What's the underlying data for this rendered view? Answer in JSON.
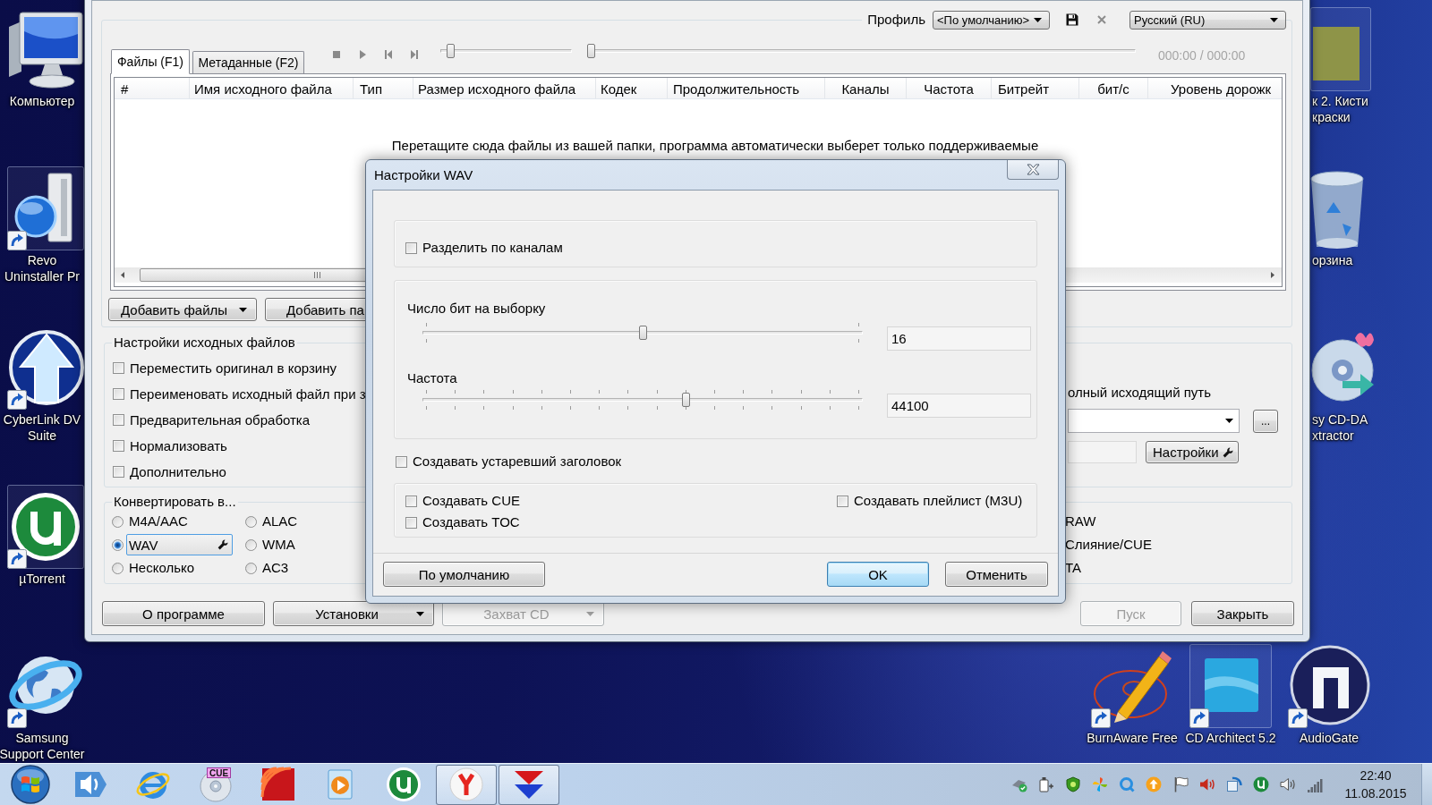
{
  "desktop": {
    "left_icons": [
      {
        "kind": "computer",
        "label_lines": [
          "Компьютер"
        ],
        "selected": false,
        "shortcut": false
      },
      {
        "kind": "uninstaller",
        "label_lines": [
          "Revo",
          "Uninstaller Pr"
        ],
        "selected": true,
        "shortcut": true
      },
      {
        "kind": "upload",
        "label_lines": [
          "CyberLink DV",
          "Suite"
        ],
        "selected": false,
        "shortcut": true
      },
      {
        "kind": "torrent",
        "label_lines": [
          "µTorrent"
        ],
        "selected": true,
        "shortcut": true
      },
      {
        "kind": "globe",
        "label_lines": [
          "Samsung",
          "Support Center"
        ],
        "selected": false,
        "shortcut": true
      }
    ],
    "right_icons": [
      {
        "kind": "photo",
        "label_lines": [
          "к 2. Кисти",
          "краски"
        ],
        "selected": true,
        "shortcut": false
      },
      {
        "kind": "bin",
        "label_lines": [
          "орзина"
        ],
        "selected": false,
        "shortcut": false
      },
      {
        "kind": "disc",
        "label_lines": [
          "sy CD-DA",
          "xtractor"
        ],
        "selected": false,
        "shortcut": false
      }
    ],
    "bottom_icons": [
      {
        "kind": "pencil",
        "label_lines": [
          "BurnAware Free"
        ],
        "selected": false,
        "shortcut": true
      },
      {
        "kind": "tile",
        "label_lines": [
          "CD Architect 5.2"
        ],
        "selected": true,
        "shortcut": true
      },
      {
        "kind": "arch",
        "label_lines": [
          "AudioGate"
        ],
        "selected": false,
        "shortcut": true
      }
    ]
  },
  "app": {
    "profile": {
      "label": "Профиль",
      "value": "<По умолчанию>"
    },
    "language": "Русский (RU)",
    "tabs": [
      {
        "label": "Файлы (F1)",
        "selected": true
      },
      {
        "label": "Метаданные (F2)",
        "selected": false
      }
    ],
    "player": {
      "buttons": [
        {
          "kind": "stop"
        },
        {
          "kind": "play"
        },
        {
          "kind": "previous"
        },
        {
          "kind": "next"
        }
      ],
      "sliders": [
        {
          "level": 0.05
        },
        {
          "level": 0
        }
      ],
      "time": "000:00 / 000:00"
    },
    "columns": [
      "#",
      "Имя исходного файла",
      "Тип",
      "Размер исходного файла",
      "Кодек",
      "Продолжительность",
      "Каналы",
      "Частота",
      "Битрейт",
      "бит/с",
      "Уровень дорожк"
    ],
    "empty_message": "Перетащите сюда файлы из вашей папки, программа автоматически выберет только поддерживаемые",
    "add_buttons": [
      {
        "label": "Добавить файлы",
        "kind": "split"
      },
      {
        "label": "Добавить па",
        "kind": "plain"
      }
    ],
    "source_settings": {
      "title": "Настройки исходных файлов",
      "options": [
        {
          "label": "Переместить оригинал в корзину",
          "checked": false
        },
        {
          "label": "Переименовать исходный файл при з",
          "checked": false
        },
        {
          "label": "Предварительная обработка",
          "checked": false
        },
        {
          "label": "Нормализовать",
          "checked": false
        },
        {
          "label": "Дополнительно",
          "checked": false
        }
      ]
    },
    "output": {
      "label": "олный исходящий путь",
      "browse": "...",
      "settings": "Настройки"
    },
    "convert": {
      "title": "Конвертировать в...",
      "formats": [
        {
          "label": "M4A/AAC",
          "selected": false
        },
        {
          "label": "WAV",
          "selected": true
        },
        {
          "label": "Несколько",
          "selected": false
        },
        {
          "label": "ALAC",
          "selected": false
        },
        {
          "label": "WMA",
          "selected": false
        },
        {
          "label": "AC3",
          "selected": false
        }
      ],
      "more_formats": [
        "RAW",
        "Слияние/CUE",
        "TA"
      ]
    },
    "footer_left": [
      {
        "label": "О программе",
        "kind": "plain",
        "disabled": false
      },
      {
        "label": "Установки",
        "kind": "split",
        "disabled": false
      },
      {
        "label": "Захват CD",
        "kind": "split",
        "disabled": true
      }
    ],
    "footer_right": [
      {
        "label": "Пуск",
        "kind": "plain",
        "disabled": true
      },
      {
        "label": "Закрыть",
        "kind": "plain",
        "disabled": false
      }
    ]
  },
  "dialog": {
    "title": "Настройки WAV",
    "split_channels": {
      "label": "Разделить по каналам",
      "checked": false
    },
    "sliders": [
      {
        "label": "Число бит на выборку",
        "kind": "coarse",
        "level": 0.5,
        "value": "16"
      },
      {
        "label": "Частота",
        "kind": "fine",
        "level": 0.6,
        "value": "44100"
      }
    ],
    "legacy_header": {
      "label": "Создавать устаревший заголовок",
      "checked": false
    },
    "extras": [
      {
        "label": "Создавать CUE",
        "checked": false
      },
      {
        "label": "Создавать TOC",
        "checked": false
      },
      {
        "label": "Создавать плейлист (M3U)",
        "checked": false
      }
    ],
    "buttons": [
      {
        "label": "По умолчанию",
        "default": false
      },
      {
        "label": "OK",
        "default": true
      },
      {
        "label": "Отменить",
        "default": false
      }
    ]
  },
  "taskbar": {
    "pinned": [
      {
        "kind": "sound",
        "running": false
      },
      {
        "kind": "browser",
        "running": false
      },
      {
        "kind": "disc",
        "badge": "CUE",
        "running": false
      },
      {
        "kind": "arcs",
        "running": false
      },
      {
        "kind": "media",
        "running": false
      },
      {
        "kind": "torrent",
        "running": false
      },
      {
        "kind": "ball",
        "running": true
      },
      {
        "kind": "triangles",
        "running": true
      }
    ],
    "tray": [
      {
        "kind": "usb"
      },
      {
        "kind": "plug"
      },
      {
        "kind": "shield"
      },
      {
        "kind": "pinwheel"
      },
      {
        "kind": "ring"
      },
      {
        "kind": "upload"
      },
      {
        "kind": "flag"
      },
      {
        "kind": "alert-speaker"
      },
      {
        "kind": "sync"
      },
      {
        "kind": "torrent"
      },
      {
        "kind": "volume"
      },
      {
        "kind": "signal"
      }
    ],
    "time": "22:40",
    "date": "11.08.2015"
  }
}
